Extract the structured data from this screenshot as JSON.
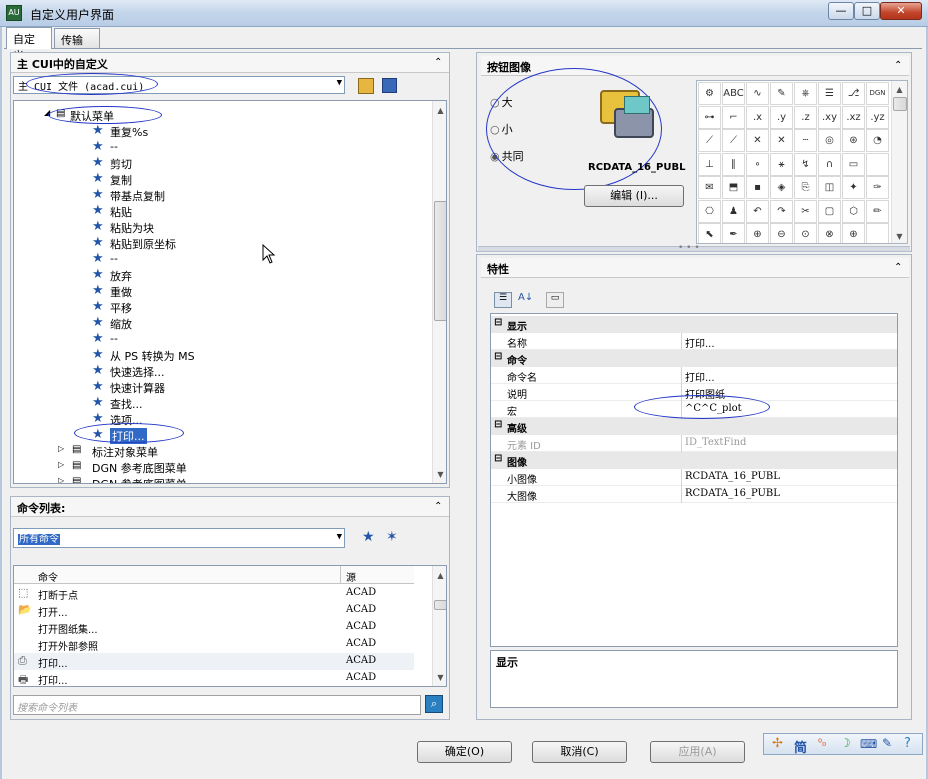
{
  "window": {
    "title": "自定义用户界面",
    "minimize": "—",
    "maximize": "□",
    "close": "✕"
  },
  "tabs": [
    {
      "label": "自定义"
    },
    {
      "label": "传输"
    }
  ],
  "cui_panel": {
    "title": "主 CUI中的自定义",
    "file_combo": "主 CUI 文件 (acad.cui)",
    "tree": {
      "parent": "默认菜单",
      "items": [
        "重复%s",
        "--",
        "剪切",
        "复制",
        "带基点复制",
        "粘贴",
        "粘贴为块",
        "粘贴到原坐标",
        "--",
        "放弃",
        "重做",
        "平移",
        "缩放",
        "--",
        "从 PS 转换为 MS",
        "快速选择...",
        "快速计算器",
        "查找...",
        "选项...",
        "打印..."
      ],
      "selected": "打印...",
      "siblings": [
        "标注对象菜单",
        "DGN 参考底图菜单",
        "DGN 参考底图菜单"
      ]
    }
  },
  "commands_panel": {
    "title": "命令列表:",
    "filter": "所有命令",
    "columns": [
      "命令",
      "源"
    ],
    "rows": [
      {
        "name": "打断于点",
        "source": "ACAD",
        "icon": "break-icon"
      },
      {
        "name": "打开...",
        "source": "ACAD",
        "icon": "open-folder-icon"
      },
      {
        "name": "打开图纸集...",
        "source": "ACAD",
        "icon": ""
      },
      {
        "name": "打开外部参照",
        "source": "ACAD",
        "icon": ""
      },
      {
        "name": "打印...",
        "source": "ACAD",
        "icon": "plot-icon"
      },
      {
        "name": "打印...",
        "source": "ACAD",
        "icon": "printer-icon"
      }
    ],
    "search_placeholder": "搜索命令列表"
  },
  "button_image_panel": {
    "title": "按钮图像",
    "sizes": [
      "大",
      "小",
      "共同"
    ],
    "selected_size": "共同",
    "image_name": "RCDATA_16_PUBL",
    "edit_label": "编辑 (I)...",
    "grid_labels": [
      ".x",
      ".y",
      ".z",
      ".xy",
      ".xz",
      ".yz",
      "DGN",
      "ABC"
    ]
  },
  "properties_panel": {
    "title": "特性",
    "categories": [
      {
        "name": "显示",
        "props": [
          {
            "name": "名称",
            "value": "打印..."
          }
        ]
      },
      {
        "name": "命令",
        "props": [
          {
            "name": "命令名",
            "value": "打印..."
          },
          {
            "name": "说明",
            "value": "打印图纸"
          },
          {
            "name": "宏",
            "value": "^C^C_plot"
          }
        ]
      },
      {
        "name": "高级",
        "props": [
          {
            "name": "元素 ID",
            "value": "ID_TextFind"
          }
        ]
      },
      {
        "name": "图像",
        "props": [
          {
            "name": "小图像",
            "value": "RCDATA_16_PUBL"
          },
          {
            "name": "大图像",
            "value": "RCDATA_16_PUBL"
          }
        ]
      }
    ],
    "description_title": "显示"
  },
  "footer": {
    "ok": "确定(O)",
    "cancel": "取消(C)",
    "apply": "应用(A)",
    "ime_label": "简"
  }
}
